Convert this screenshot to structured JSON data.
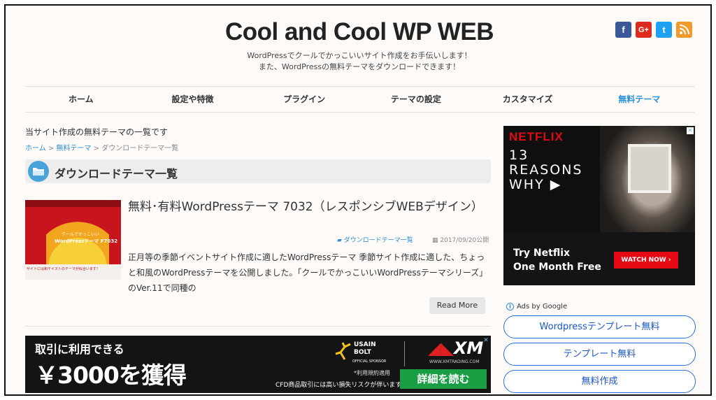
{
  "header": {
    "title": "Cool and Cool WP WEB",
    "tagline_1": "WordPressでクールでかっこいいサイト作成をお手伝いします！",
    "tagline_2": "また、WordPressの無料テーマをダウンロードできます！"
  },
  "social": [
    {
      "name": "facebook",
      "glyph": "f",
      "color": "#3b5998"
    },
    {
      "name": "google-plus",
      "glyph": "G+",
      "color": "#dd2b1f"
    },
    {
      "name": "twitter",
      "glyph": "t",
      "color": "#1da1f2"
    },
    {
      "name": "rss",
      "glyph": "❩",
      "color": "#f2992b"
    }
  ],
  "nav": {
    "items": [
      "ホーム",
      "設定や特徴",
      "プラグイン",
      "テーマの設定",
      "カスタマイズ",
      "無料テーマ"
    ],
    "active_index": 5
  },
  "page": {
    "intro": "当サイト作成の無料テーマの一覧です",
    "breadcrumb": {
      "home": "ホーム",
      "sep1": " > ",
      "parent": "無料テーマ",
      "sep2": " > ",
      "current": "ダウンロードテーマ一覧"
    },
    "section_title": "ダウンロードテーマ一覧"
  },
  "post": {
    "thumb_caption": "クールでかっこいい",
    "thumb_theme": "WordPressテーマ F7032",
    "thumb_footer": "サイトには和テイストのテーマが似合います！",
    "title": "無料･有料WordPressテーマ 7032（レスポンシブWEBデザイン）",
    "category": "ダウンロードテーマ一覧",
    "date": "2017/09/20公開",
    "excerpt": "正月等の季節イベントサイト作成に適したWordPressテーマ 季節サイト作成に適した、ちょっと和風のWordPressテーマを公開しました。「クールでかっこいいWordPressテーマシリーズ」のVer.11で同種の",
    "read_more": "Read More"
  },
  "ad_bottom": {
    "line1": "取引に利用できる",
    "line2": "￥3000を獲得",
    "usain_1": "USAIN",
    "usain_2": "BOLT",
    "sponsor": "OFFICIAL SPONSOR",
    "brand": "XM",
    "url": "WWW.XMTRADING.COM",
    "disclaimer_1": "*利用規約適用",
    "disclaimer_2": "CFD商品取引には高い損失リスクが伴います。",
    "cta": "詳細を読む"
  },
  "ad_netflix": {
    "logo": "NETFLIX",
    "show_1": "13",
    "show_2": "REASONS",
    "show_3": "WHY ▶",
    "try_1": "Try Netflix",
    "try_2": "One Month Free",
    "watch": "WATCH NOW ›"
  },
  "ads_by_google": "Ads by Google",
  "ad_links": [
    "Wordpressテンプレート無料",
    "テンプレート無料",
    "無料作成"
  ],
  "colors": {
    "accent": "#2a8fd6",
    "netflix_red": "#e50914",
    "cta_green": "#1a9e44"
  }
}
